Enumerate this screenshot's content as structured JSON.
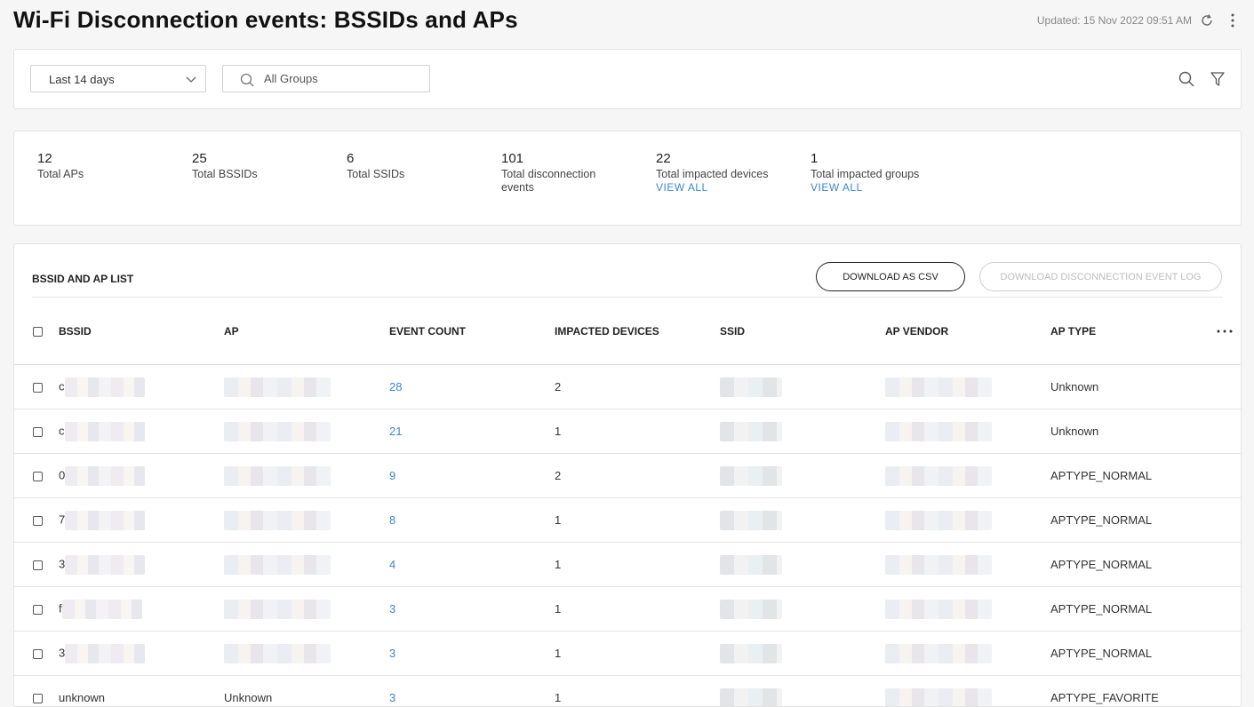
{
  "header": {
    "title": "Wi-Fi Disconnection events: BSSIDs and APs",
    "updated": "Updated: 15 Nov 2022 09:51 AM"
  },
  "filters": {
    "date_range": "Last 14 days",
    "group_search": "All Groups"
  },
  "stats": [
    {
      "value": "12",
      "label": "Total APs",
      "link": ""
    },
    {
      "value": "25",
      "label": "Total BSSIDs",
      "link": ""
    },
    {
      "value": "6",
      "label": "Total SSIDs",
      "link": ""
    },
    {
      "value": "101",
      "label": "Total disconnection events",
      "link": ""
    },
    {
      "value": "22",
      "label": "Total impacted devices",
      "link": "VIEW ALL"
    },
    {
      "value": "1",
      "label": "Total impacted groups",
      "link": "VIEW ALL"
    }
  ],
  "list": {
    "title": "BSSID AND AP LIST",
    "download_csv": "DOWNLOAD AS CSV",
    "download_log": "DOWNLOAD DISCONNECTION EVENT LOG",
    "columns": [
      "BSSID",
      "AP",
      "EVENT COUNT",
      "IMPACTED DEVICES",
      "SSID",
      "AP VENDOR",
      "AP TYPE"
    ],
    "rows": [
      {
        "bssid": "c",
        "ap": "",
        "event_count": "28",
        "impacted_devices": "2",
        "ssid": "",
        "ap_vendor": "",
        "ap_type": "Unknown"
      },
      {
        "bssid": "c",
        "ap": "",
        "event_count": "21",
        "impacted_devices": "1",
        "ssid": "",
        "ap_vendor": "",
        "ap_type": "Unknown"
      },
      {
        "bssid": "0",
        "ap": "",
        "event_count": "9",
        "impacted_devices": "2",
        "ssid": "",
        "ap_vendor": "",
        "ap_type": "APTYPE_NORMAL"
      },
      {
        "bssid": "7",
        "ap": "",
        "event_count": "8",
        "impacted_devices": "1",
        "ssid": "",
        "ap_vendor": "",
        "ap_type": "APTYPE_NORMAL"
      },
      {
        "bssid": "3",
        "ap": "",
        "event_count": "4",
        "impacted_devices": "1",
        "ssid": "",
        "ap_vendor": "",
        "ap_type": "APTYPE_NORMAL"
      },
      {
        "bssid": "f",
        "ap": "",
        "event_count": "3",
        "impacted_devices": "1",
        "ssid": "",
        "ap_vendor": "",
        "ap_type": "APTYPE_NORMAL"
      },
      {
        "bssid": "3",
        "ap": "",
        "event_count": "3",
        "impacted_devices": "1",
        "ssid": "",
        "ap_vendor": "",
        "ap_type": "APTYPE_NORMAL"
      },
      {
        "bssid": "unknown",
        "ap": "Unknown",
        "event_count": "3",
        "impacted_devices": "1",
        "ssid": "",
        "ap_vendor": "",
        "ap_type": "APTYPE_FAVORITE"
      }
    ]
  }
}
